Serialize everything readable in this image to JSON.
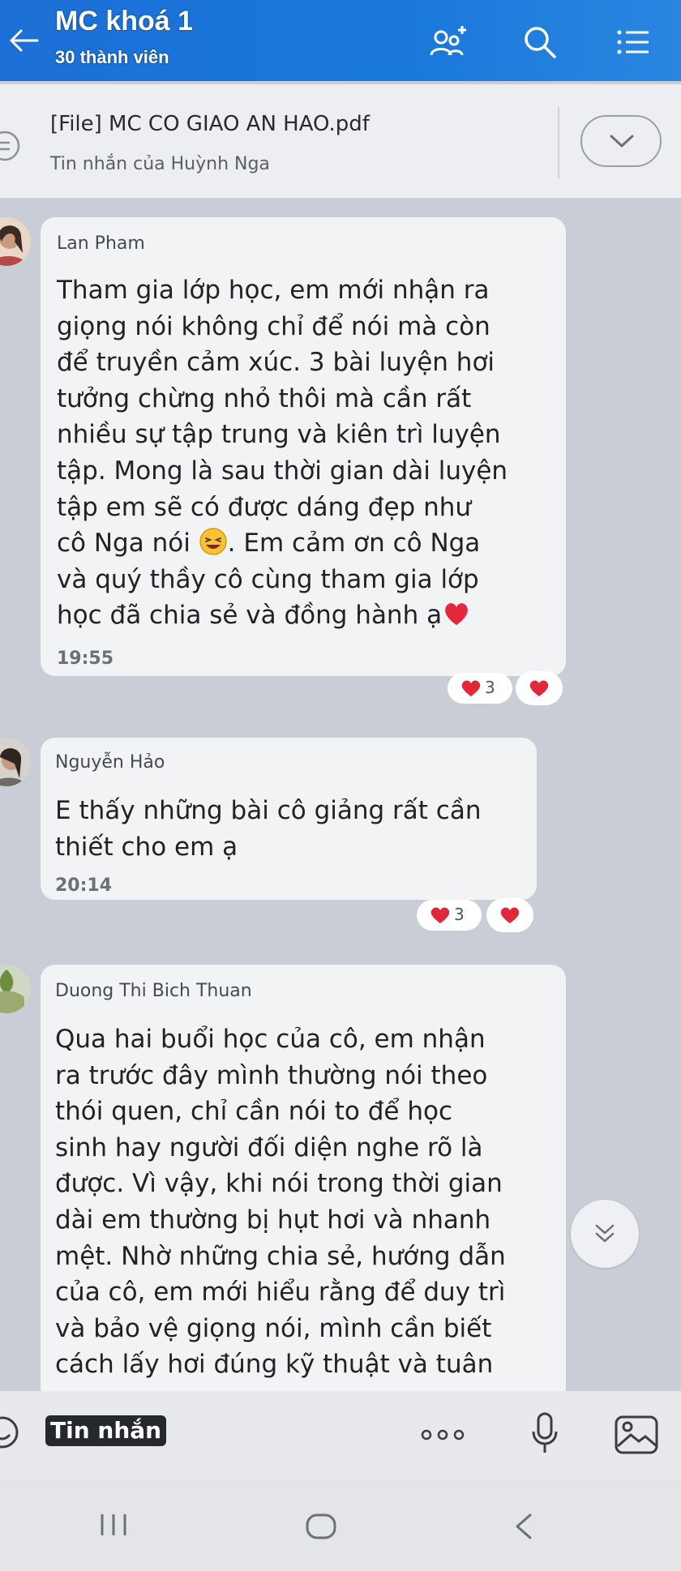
{
  "header": {
    "title": "MC khoá 1",
    "subtitle": "30 thành viên",
    "icons": [
      "back-arrow-icon",
      "add-member-icon",
      "search-icon",
      "menu-list-icon"
    ],
    "background": "#1c6fd6"
  },
  "pinned": {
    "file_name": "[File] MC CO GIAO AN HAO.pdf",
    "sender_line": "Tin nhắn của Huỳnh Nga"
  },
  "messages": [
    {
      "sender": "Lan Pham",
      "lines": [
        "Tham gia lớp học, em mới nhận ra",
        "giọng nói không chỉ để nói mà còn",
        "để truyền cảm xúc. 3 bài luyện hơi",
        "tưởng chừng nhỏ thôi mà cần rất",
        "nhiều sự tập trung và kiên trì luyện",
        "tập. Mong là sau thời gian dài luyện",
        "tập em sẽ có được dáng đẹp như",
        "cô Nga nói",
        ". Em cảm ơn cô Nga",
        "và quý thầy cô cùng tham gia lớp",
        "học đã chia sẻ và đồng hành ạ"
      ],
      "time": "19:55",
      "reaction_count": "3"
    },
    {
      "sender": "Nguyễn Hảo",
      "lines": [
        "E thấy những bài cô giảng rất cần",
        "thiết cho em ạ"
      ],
      "time": "20:14",
      "reaction_count": "3"
    },
    {
      "sender": "Duong Thi Bich Thuan",
      "lines": [
        "Qua hai buổi học của cô, em nhận",
        "ra trước đây mình thường nói theo",
        "thói quen, chỉ cần nói to để học",
        "sinh hay người đối diện nghe rõ là",
        "được. Vì vậy, khi nói trong thời gian",
        "dài em thường bị hụt hơi và nhanh",
        "mệt. Nhờ những chia sẻ, hướng dẫn",
        "của cô, em mới hiểu rằng để duy trì",
        "và bảo vệ giọng nói, mình cần biết",
        "cách lấy hơi đúng kỹ thuật và tuân"
      ]
    }
  ],
  "input": {
    "placeholder": "Tin nhắn"
  },
  "colors": {
    "chat_background": "#c9ced6",
    "bubble": "#f2f3f5",
    "heart": "#e0283a"
  }
}
